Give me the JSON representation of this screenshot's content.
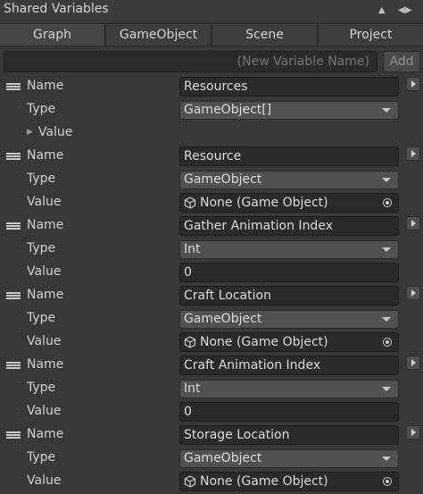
{
  "window": {
    "title": "Shared Variables",
    "collapse_icon": "triangle-up-icon",
    "more_icon": "arrows-horizontal-icon"
  },
  "tabs": [
    {
      "label": "Graph",
      "active": true
    },
    {
      "label": "GameObject",
      "active": false
    },
    {
      "label": "Scene",
      "active": false
    },
    {
      "label": "Project",
      "active": false
    }
  ],
  "new_variable": {
    "placeholder": "(New Variable Name)",
    "add_label": "Add"
  },
  "variables": [
    {
      "name_label": "Name",
      "name": "Resources",
      "type_label": "Type",
      "type": "GameObject[]",
      "value_label": "Value",
      "value_kind": "foldout",
      "value": ""
    },
    {
      "name_label": "Name",
      "name": "Resource",
      "type_label": "Type",
      "type": "GameObject",
      "value_label": "Value",
      "value_kind": "object",
      "value": "None (Game Object)"
    },
    {
      "name_label": "Name",
      "name": "Gather Animation Index",
      "type_label": "Type",
      "type": "Int",
      "value_label": "Value",
      "value_kind": "text",
      "value": "0"
    },
    {
      "name_label": "Name",
      "name": "Craft Location",
      "type_label": "Type",
      "type": "GameObject",
      "value_label": "Value",
      "value_kind": "object",
      "value": "None (Game Object)"
    },
    {
      "name_label": "Name",
      "name": "Craft Animation Index",
      "type_label": "Type",
      "type": "Int",
      "value_label": "Value",
      "value_kind": "text",
      "value": "0"
    },
    {
      "name_label": "Name",
      "name": "Storage Location",
      "type_label": "Type",
      "type": "GameObject",
      "value_label": "Value",
      "value_kind": "object",
      "value": "None (Game Object)"
    }
  ]
}
